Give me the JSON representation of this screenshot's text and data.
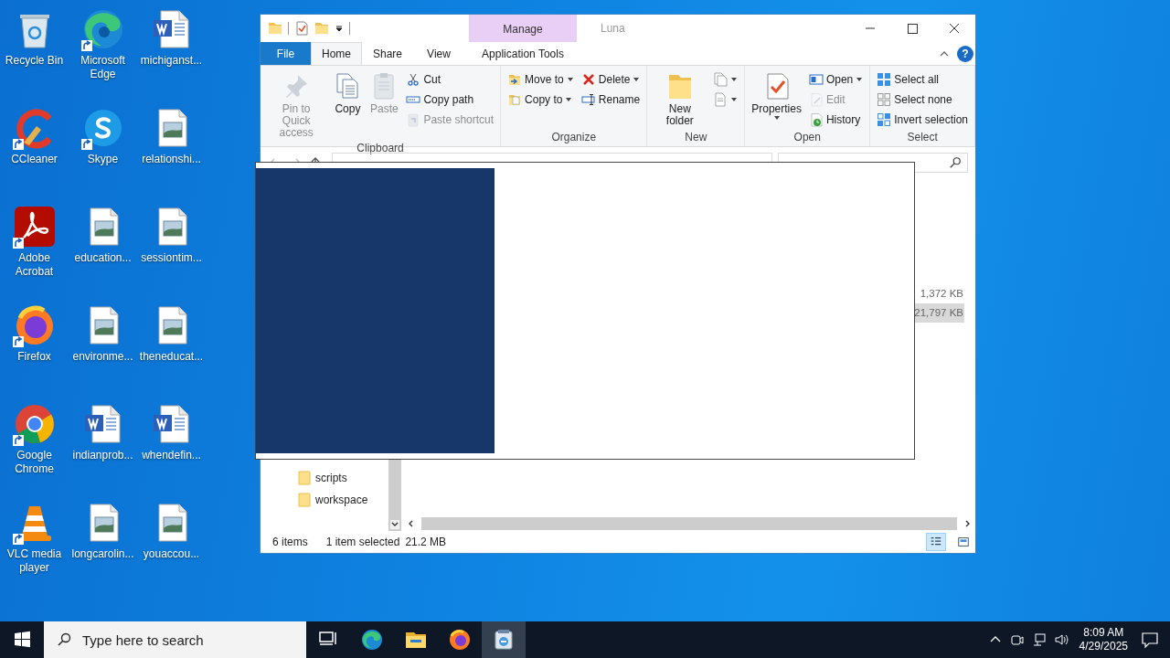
{
  "desktop_icons": [
    {
      "label": "Recycle Bin",
      "kind": "recycle",
      "shortcut": false
    },
    {
      "label": "CCleaner",
      "kind": "ccleaner",
      "shortcut": true
    },
    {
      "label": "Adobe Acrobat",
      "kind": "acrobat",
      "shortcut": true
    },
    {
      "label": "Firefox",
      "kind": "firefox",
      "shortcut": true
    },
    {
      "label": "Google Chrome",
      "kind": "chrome",
      "shortcut": true
    },
    {
      "label": "VLC media player",
      "kind": "vlc",
      "shortcut": true
    },
    {
      "label": "Microsoft Edge",
      "kind": "edge",
      "shortcut": true
    },
    {
      "label": "Skype",
      "kind": "skype",
      "shortcut": true
    },
    {
      "label": "education...",
      "kind": "image",
      "shortcut": false
    },
    {
      "label": "environme...",
      "kind": "image",
      "shortcut": false
    },
    {
      "label": "indianprob...",
      "kind": "word",
      "shortcut": false
    },
    {
      "label": "longcarolin...",
      "kind": "image",
      "shortcut": false
    },
    {
      "label": "michiganst...",
      "kind": "word",
      "shortcut": false
    },
    {
      "label": "relationshi...",
      "kind": "image",
      "shortcut": false
    },
    {
      "label": "sessiontim...",
      "kind": "image",
      "shortcut": false
    },
    {
      "label": "theneducat...",
      "kind": "image",
      "shortcut": false
    },
    {
      "label": "whendefin...",
      "kind": "word",
      "shortcut": false
    },
    {
      "label": "youaccou...",
      "kind": "image",
      "shortcut": false
    }
  ],
  "explorer": {
    "title": "Luna",
    "contextual_group": "Manage",
    "help_button": "?",
    "tabs": [
      {
        "label": "File",
        "kind": "file",
        "selected": false
      },
      {
        "label": "Home",
        "kind": "normal",
        "selected": true
      },
      {
        "label": "Share",
        "kind": "normal",
        "selected": false
      },
      {
        "label": "View",
        "kind": "normal",
        "selected": false
      }
    ],
    "contextual_tab": {
      "label": "Application Tools",
      "selected": false
    },
    "ribbon": [
      {
        "label": "Clipboard",
        "columns": [
          {
            "kind": "large",
            "items": [
              {
                "label": "Pin to Quick access",
                "disabled": true,
                "dropdown": false
              }
            ]
          },
          {
            "kind": "large",
            "items": [
              {
                "label": "Copy",
                "disabled": false,
                "dropdown": false
              }
            ]
          },
          {
            "kind": "large",
            "items": [
              {
                "label": "Paste",
                "disabled": true,
                "dropdown": false
              }
            ]
          },
          {
            "kind": "small",
            "items": [
              {
                "label": "Cut",
                "disabled": false,
                "dropdown": false
              },
              {
                "label": "Copy path",
                "disabled": false,
                "dropdown": false
              },
              {
                "label": "Paste shortcut",
                "disabled": true,
                "dropdown": false
              }
            ]
          }
        ]
      },
      {
        "label": "Organize",
        "columns": [
          {
            "kind": "small",
            "items": [
              {
                "label": "Move to",
                "disabled": false,
                "dropdown": true
              },
              {
                "label": "Copy to",
                "disabled": false,
                "dropdown": true
              }
            ]
          },
          {
            "kind": "small",
            "items": [
              {
                "label": "Delete",
                "disabled": false,
                "dropdown": true
              },
              {
                "label": "Rename",
                "disabled": false,
                "dropdown": false
              }
            ]
          }
        ]
      },
      {
        "label": "New",
        "columns": [
          {
            "kind": "large",
            "items": [
              {
                "label": "New folder",
                "disabled": false,
                "dropdown": false
              }
            ]
          },
          {
            "kind": "small",
            "items": [
              {
                "disabled": false,
                "dropdown": true
              },
              {
                "disabled": false,
                "dropdown": true
              }
            ]
          }
        ]
      },
      {
        "label": "Open",
        "columns": [
          {
            "kind": "large",
            "items": [
              {
                "label": "Properties",
                "disabled": false,
                "dropdown": true
              }
            ]
          },
          {
            "kind": "small",
            "items": [
              {
                "label": "Open",
                "disabled": false,
                "dropdown": true
              },
              {
                "label": "Edit",
                "disabled": true,
                "dropdown": false
              },
              {
                "label": "History",
                "disabled": false,
                "dropdown": false
              }
            ]
          }
        ]
      },
      {
        "label": "Select",
        "columns": [
          {
            "kind": "small",
            "items": [
              {
                "label": "Select all",
                "disabled": false,
                "dropdown": false
              },
              {
                "label": "Select none",
                "disabled": false,
                "dropdown": false
              },
              {
                "label": "Invert selection",
                "disabled": false,
                "dropdown": false
              }
            ]
          }
        ]
      }
    ],
    "nav_items": [
      "scripts",
      "workspace"
    ],
    "files": [
      {
        "size": "1,372 KB",
        "selected": false
      },
      {
        "size": "21,797 KB",
        "selected": true
      }
    ],
    "status": {
      "count": "6 items",
      "selection": "1 item selected",
      "size": "21.2 MB"
    },
    "views": [
      {
        "kind": "details",
        "selected": true
      },
      {
        "kind": "tiles",
        "selected": false
      }
    ]
  },
  "taskbar": {
    "search_placeholder": "Type here to search",
    "apps": [
      {
        "kind": "taskview",
        "selected": false
      },
      {
        "kind": "edge",
        "selected": false
      },
      {
        "kind": "explorer",
        "selected": false
      },
      {
        "kind": "firefox",
        "selected": false
      },
      {
        "kind": "installer",
        "selected": true
      }
    ],
    "time": "8:09 AM",
    "date": "4/29/2025"
  }
}
